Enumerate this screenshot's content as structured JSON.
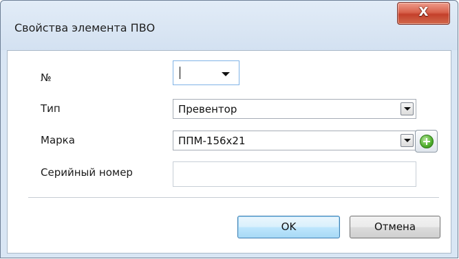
{
  "window": {
    "title": "Свойства элемента ПВО",
    "close_label": "X"
  },
  "form": {
    "number": {
      "label": "№",
      "value": ""
    },
    "type": {
      "label": "Тип",
      "value": "Превентор"
    },
    "brand": {
      "label": "Марка",
      "value": "ППМ-156х21",
      "add_icon": "green-plus-circle-icon"
    },
    "serial": {
      "label": "Серийный номер",
      "value": ""
    }
  },
  "buttons": {
    "ok": "OK",
    "cancel": "Отмена"
  },
  "colors": {
    "title_bar": "#d9e6f4",
    "close_button": "#c3402b",
    "ok_button_border": "#3c7fb1",
    "add_icon": "#4eae2c"
  }
}
